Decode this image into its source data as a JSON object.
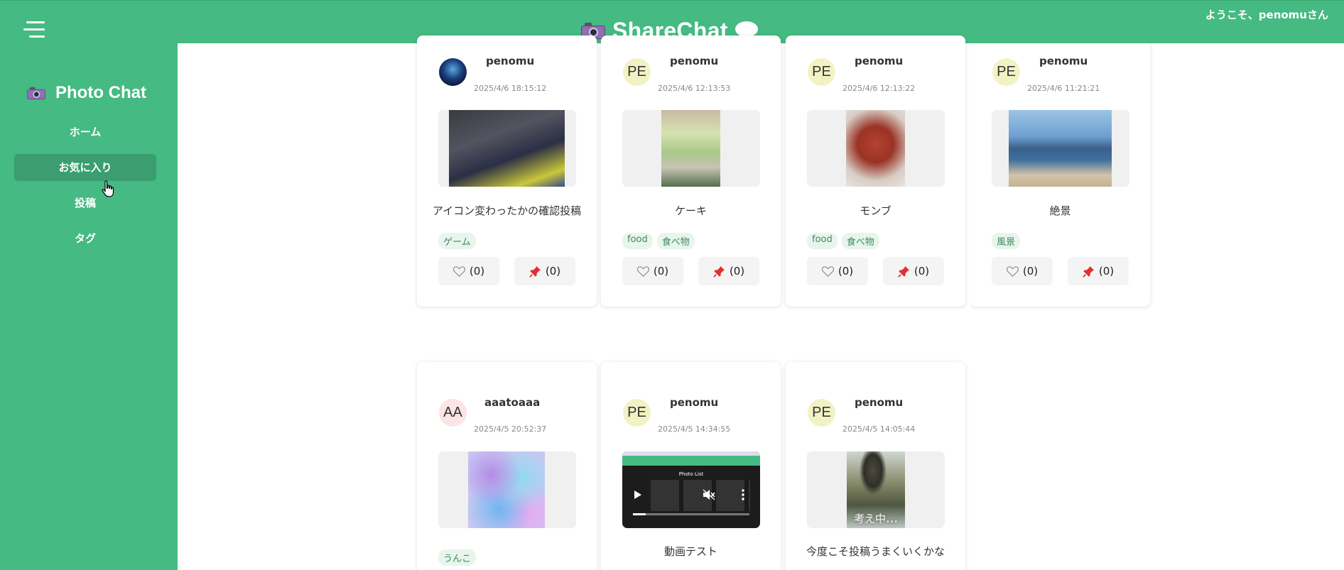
{
  "header": {
    "title": "ShareChat",
    "welcome": "ようこそ、penomuさん"
  },
  "sidebar": {
    "title": "Photo Chat",
    "items": [
      {
        "label": "ホーム"
      },
      {
        "label": "お気に入り",
        "active": true
      },
      {
        "label": "投稿"
      },
      {
        "label": "タグ"
      }
    ]
  },
  "posts": [
    {
      "user": "penomu",
      "avatar": "",
      "date": "2025/4/6 18:15:12",
      "caption": "アイコン変わったかの確認投稿",
      "tags": [
        "ゲーム"
      ],
      "likes": "(0)",
      "favorites": "(0)"
    },
    {
      "user": "penomu",
      "avatar": "PE",
      "date": "2025/4/6 12:13:53",
      "caption": "ケーキ",
      "tags": [
        "food",
        "食べ物"
      ],
      "likes": "(0)",
      "favorites": "(0)"
    },
    {
      "user": "penomu",
      "avatar": "PE",
      "date": "2025/4/6 12:13:22",
      "caption": "モンブ",
      "tags": [
        "food",
        "食べ物"
      ],
      "likes": "(0)",
      "favorites": "(0)"
    },
    {
      "user": "penomu",
      "avatar": "PE",
      "date": "2025/4/6 11:21:21",
      "caption": "絶景",
      "tags": [
        "風景"
      ],
      "likes": "(0)",
      "favorites": "(0)"
    },
    {
      "user": "aaatoaaa",
      "avatar": "AA",
      "date": "2025/4/5 20:52:37",
      "caption": "",
      "tags": [
        "うんこ"
      ]
    },
    {
      "user": "penomu",
      "avatar": "PE",
      "date": "2025/4/5 14:34:55",
      "caption": "動画テスト",
      "tags": []
    },
    {
      "user": "penomu",
      "avatar": "PE",
      "date": "2025/4/5 14:05:44",
      "caption": "今度こそ投稿うまくいくかな",
      "tags": []
    }
  ],
  "video": {
    "title": "Photo List"
  },
  "overlays": {
    "thinking": "考え中..."
  },
  "colors": {
    "brand": "#45ba82",
    "active": "#3a9e70"
  }
}
